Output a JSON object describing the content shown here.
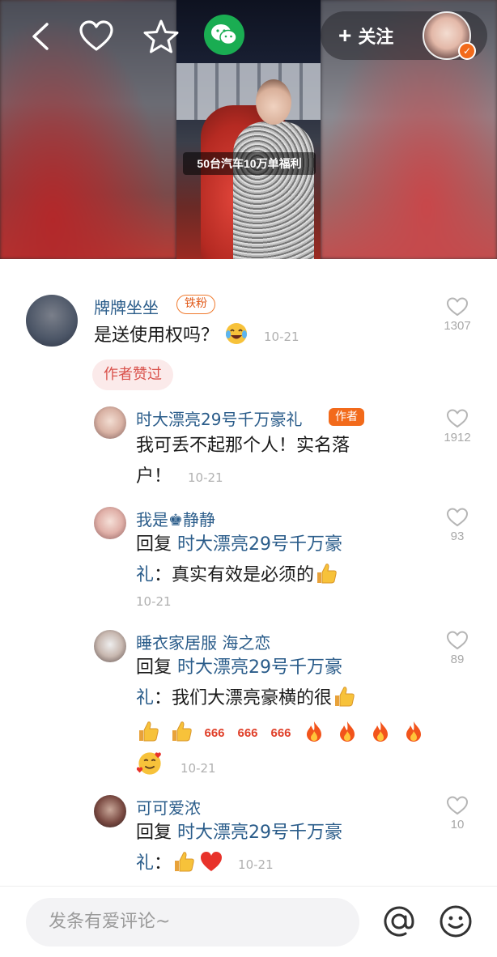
{
  "video": {
    "caption": "50台汽车10万单福利"
  },
  "topbar": {
    "follow_label": "关注",
    "follow_plus": "+",
    "icons": [
      "back-icon",
      "heart-icon",
      "star-icon",
      "wechat-icon"
    ],
    "verified": "✓"
  },
  "comments": [
    {
      "name": "牌牌坐坐",
      "badge": "铁粉",
      "text": "是送使用权吗？",
      "emoji": "crying-laughing",
      "time": "10-21",
      "likes": "1307",
      "author_liked": "作者赞过",
      "replies": [
        {
          "name": "时大漂亮29号千万豪礼",
          "badge": "作者",
          "text_line1": "我可丢不起那个人！实名落",
          "text_line2": "户！",
          "time": "10-21",
          "likes": "1912"
        },
        {
          "name": "我是♚静静",
          "reply_prefix": "回复",
          "reply_target_line1": "时大漂亮29号千万豪",
          "reply_target_line2": "礼",
          "text": "：真实有效是必须的",
          "emoji": [
            "thumbs-up"
          ],
          "time": "10-21",
          "likes": "93"
        },
        {
          "name": "睡衣家居服 海之恋",
          "reply_prefix": "回复",
          "reply_target_line1": "时大漂亮29号千万豪",
          "reply_target_line2": "礼",
          "text": "：我们大漂亮豪横的很",
          "emoji": [
            "thumbs-up",
            "thumbs-up",
            "thumbs-up",
            "666",
            "666",
            "666",
            "fire",
            "fire",
            "fire",
            "fire",
            "smiling-hearts"
          ],
          "time": "10-21",
          "likes": "89"
        },
        {
          "name": "可可爱浓",
          "reply_prefix": "回复",
          "reply_target_line1": "时大漂亮29号千万豪",
          "reply_target_line2": "礼",
          "text": "：",
          "emoji": [
            "thumbs-up",
            "red-heart"
          ],
          "time": "10-21",
          "likes": "10"
        }
      ]
    }
  ],
  "bottom_bar": {
    "input_placeholder": "发条有爱评论~",
    "icons": [
      "at-icon",
      "emoji-icon"
    ]
  },
  "colors": {
    "name_blue": "#2a5c8a",
    "accent_orange": "#f26a1b",
    "wechat_green": "#1aad52",
    "liked_pink": "#fbeaea"
  }
}
